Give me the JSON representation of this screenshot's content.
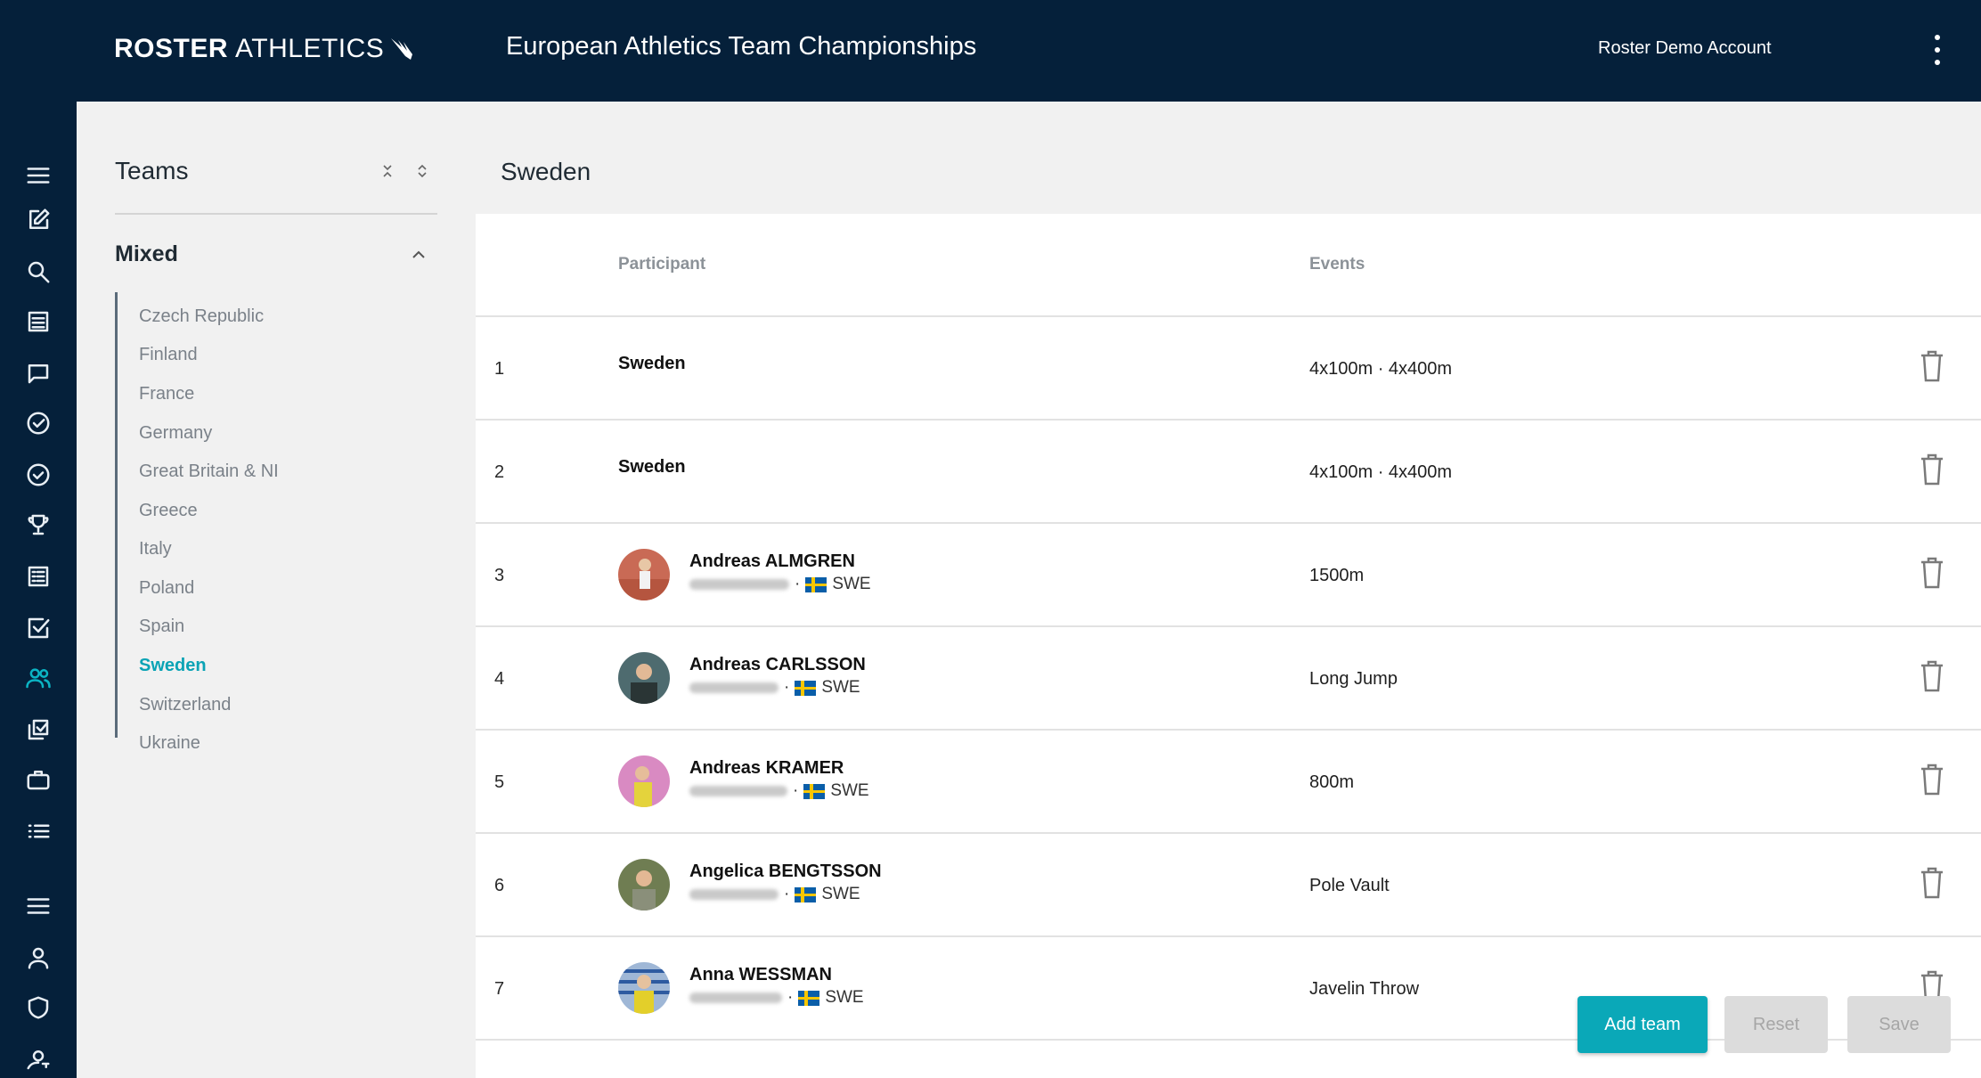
{
  "header": {
    "logo_bold": "ROSTER",
    "logo_light": "ATHLETICS",
    "app_title": "European Athletics Team Championships",
    "account": "Roster Demo Account"
  },
  "rail": {
    "icons": [
      "menu-icon",
      "edit-icon",
      "search-icon",
      "document-icon",
      "chat-icon",
      "check-circle-icon",
      "clock-check-icon",
      "trophy-icon",
      "list-doc-icon",
      "checkbox-icon",
      "people-icon",
      "multi-check-icon",
      "briefcase-icon",
      "bullet-list-icon",
      "menu-icon",
      "person-icon",
      "shield-icon",
      "person-key-icon"
    ],
    "active": "people-icon"
  },
  "teams_panel": {
    "title": "Teams",
    "group": "Mixed",
    "teams": [
      "Czech Republic",
      "Finland",
      "France",
      "Germany",
      "Great Britain & NI",
      "Greece",
      "Italy",
      "Poland",
      "Spain",
      "Sweden",
      "Switzerland",
      "Ukraine"
    ],
    "active_team": "Sweden"
  },
  "detail": {
    "title": "Sweden",
    "columns": {
      "participant": "Participant",
      "events": "Events"
    },
    "rows": [
      {
        "num": "1",
        "name": "Sweden",
        "events": "4x100m · 4x400m"
      },
      {
        "num": "2",
        "name": "Sweden",
        "events": "4x100m · 4x400m"
      },
      {
        "num": "3",
        "name": "Andreas ALMGREN",
        "sub_sep": "·",
        "country": "SWE",
        "events": "1500m"
      },
      {
        "num": "4",
        "name": "Andreas CARLSSON",
        "sub_sep": "·",
        "country": "SWE",
        "events": "Long Jump"
      },
      {
        "num": "5",
        "name": "Andreas KRAMER",
        "sub_sep": "·",
        "country": "SWE",
        "events": "800m"
      },
      {
        "num": "6",
        "name": "Angelica BENGTSSON",
        "sub_sep": "·",
        "country": "SWE",
        "events": "Pole Vault"
      },
      {
        "num": "7",
        "name": "Anna WESSMAN",
        "sub_sep": "·",
        "country": "SWE",
        "events": "Javelin Throw"
      }
    ]
  },
  "actions": {
    "add_team": "Add team",
    "reset": "Reset",
    "save": "Save"
  },
  "colors": {
    "navy": "#05203a",
    "accent": "#0aa8b8"
  }
}
